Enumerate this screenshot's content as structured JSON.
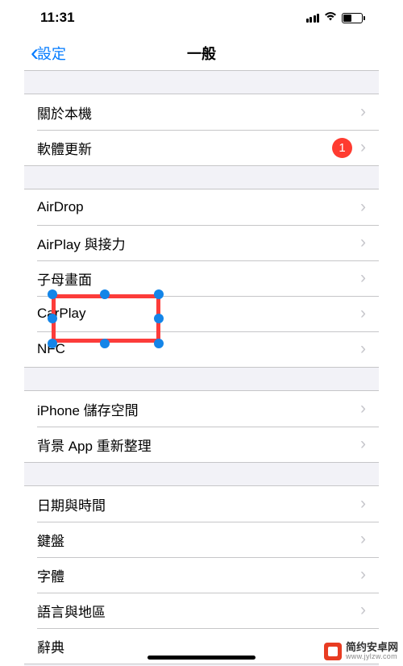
{
  "status_bar": {
    "time": "11:31"
  },
  "nav": {
    "back_label": "設定",
    "title": "一般"
  },
  "sections": [
    {
      "rows": [
        {
          "label": "關於本機"
        },
        {
          "label": "軟體更新",
          "badge": "1"
        }
      ]
    },
    {
      "rows": [
        {
          "label": "AirDrop"
        },
        {
          "label": "AirPlay 與接力"
        },
        {
          "label": "子母畫面"
        },
        {
          "label": "CarPlay"
        },
        {
          "label": "NFC"
        }
      ]
    },
    {
      "rows": [
        {
          "label": "iPhone 儲存空間"
        },
        {
          "label": "背景 App 重新整理"
        }
      ]
    },
    {
      "rows": [
        {
          "label": "日期與時間"
        },
        {
          "label": "鍵盤"
        },
        {
          "label": "字體"
        },
        {
          "label": "語言與地區"
        },
        {
          "label": "辭典"
        }
      ]
    }
  ],
  "watermark": {
    "name": "简约安卓网",
    "url": "www.jylzw.com"
  }
}
